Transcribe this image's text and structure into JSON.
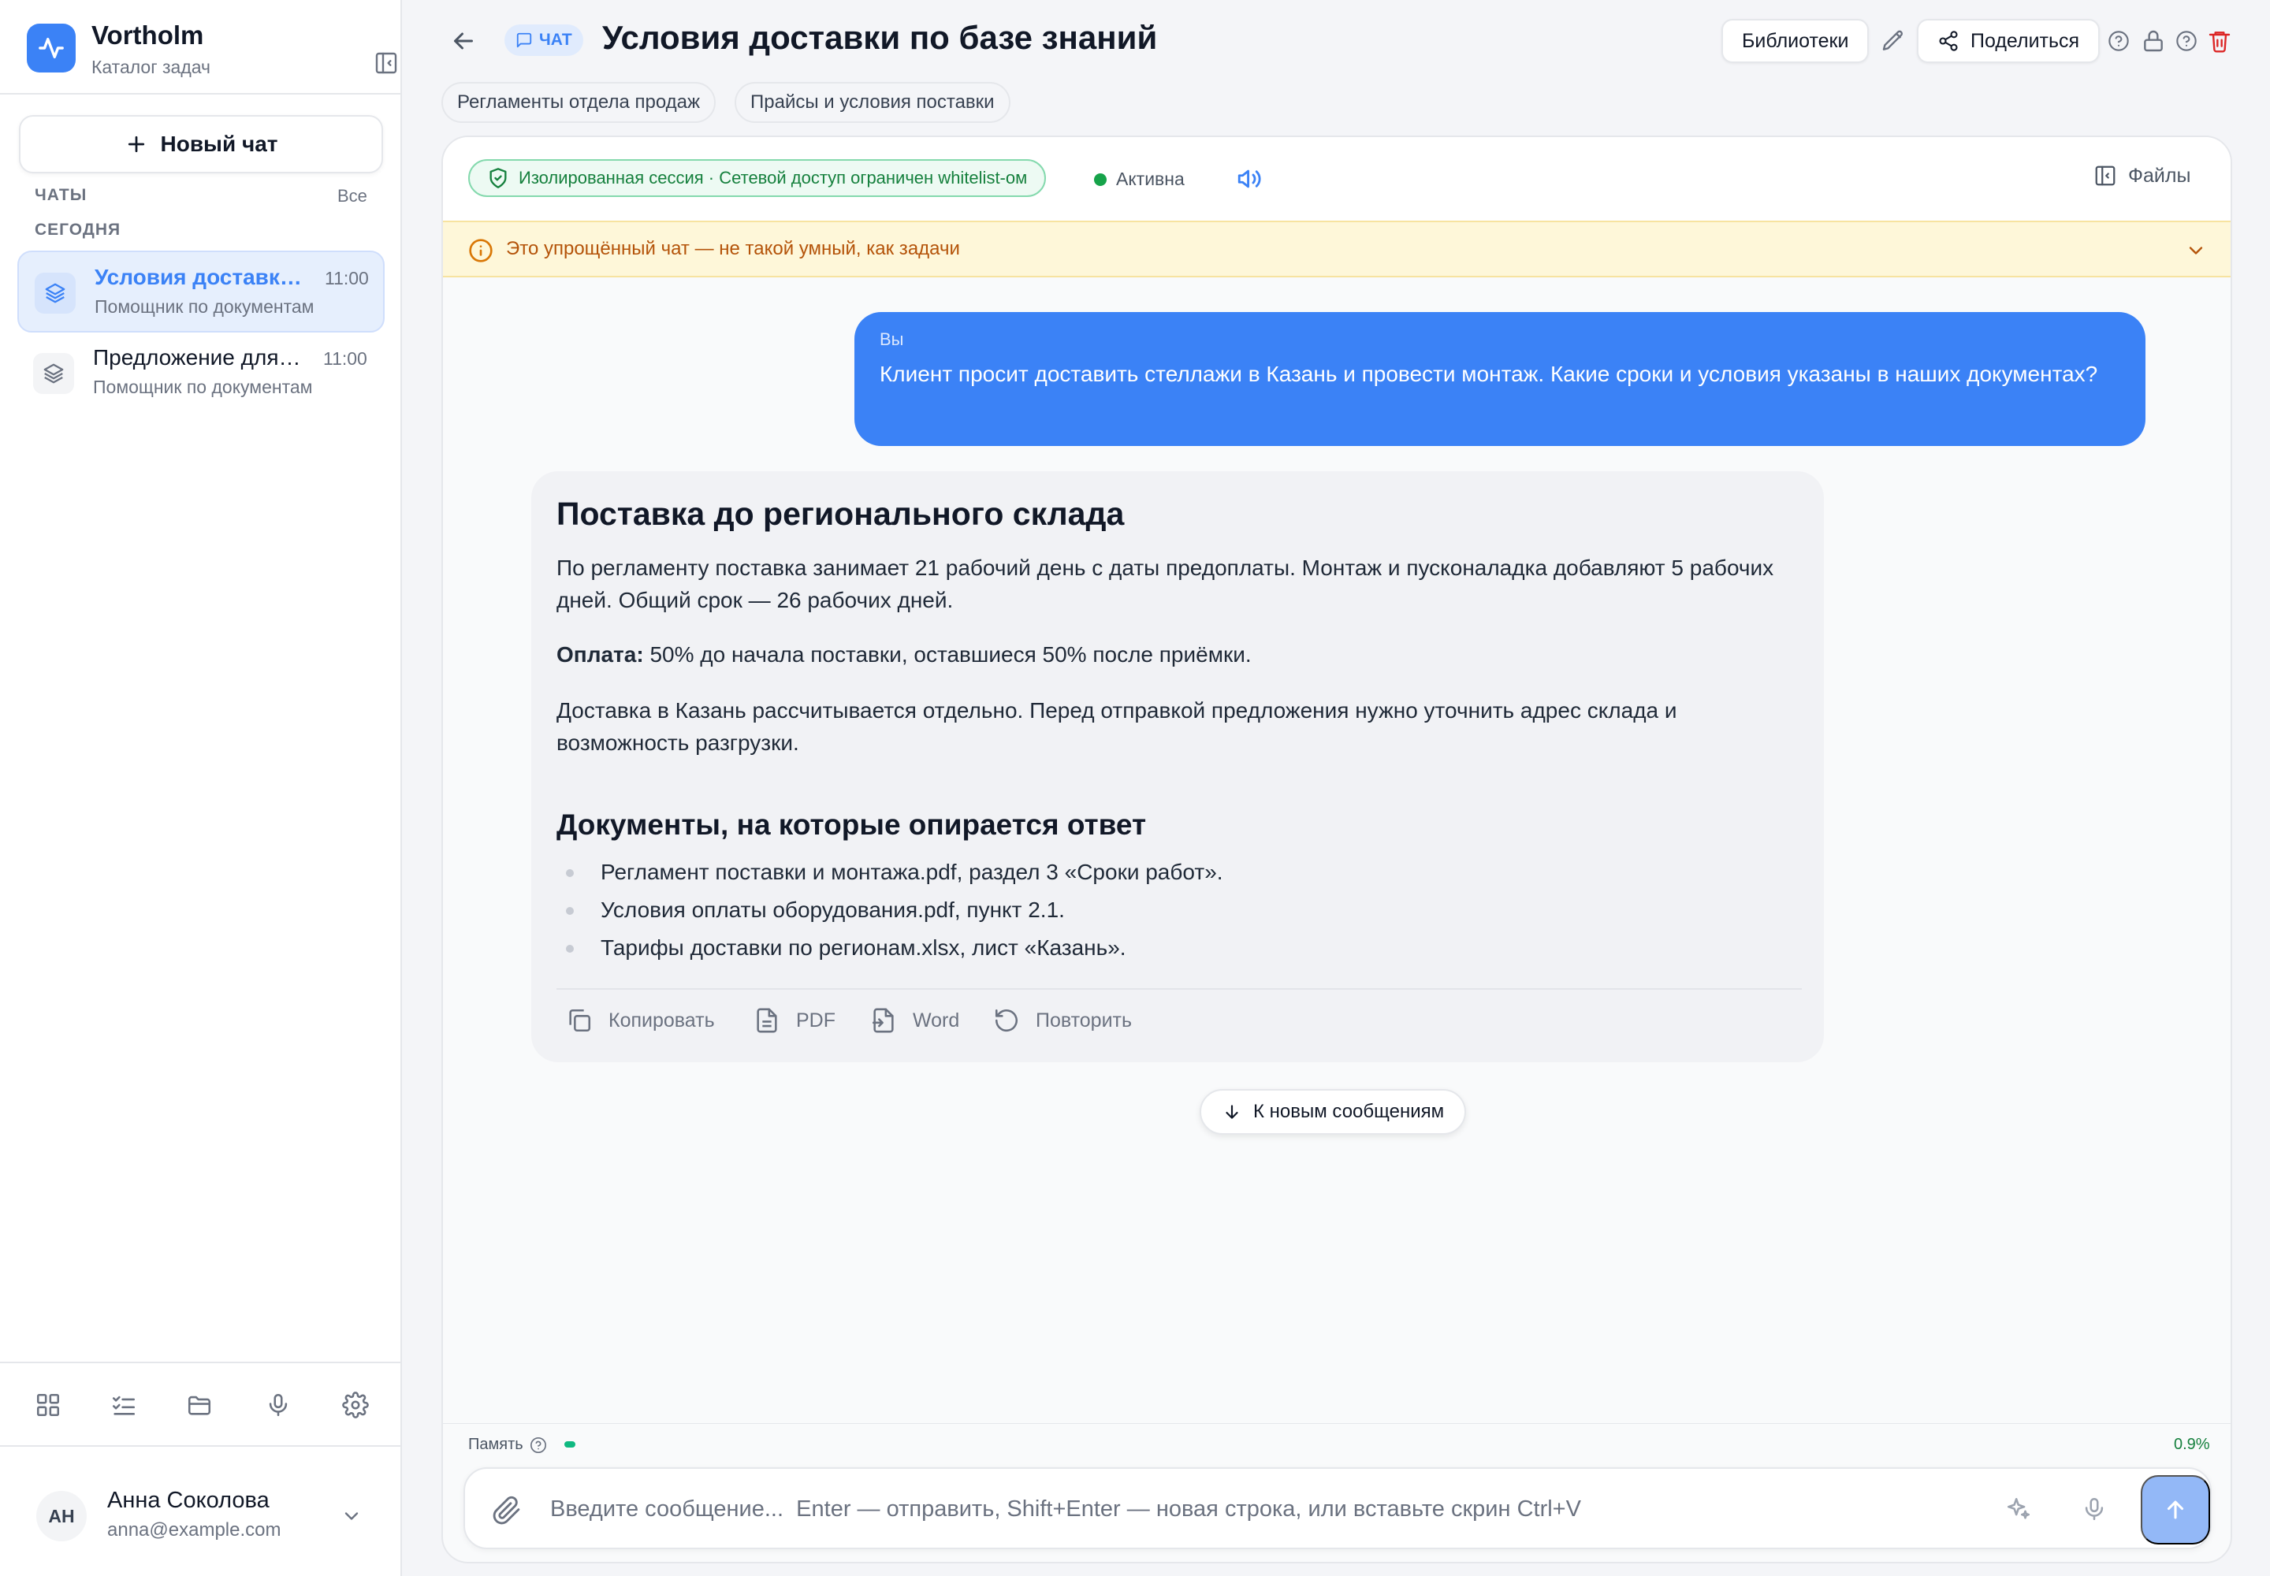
{
  "app": {
    "name": "Vortholm",
    "subtitle": "Каталог задач"
  },
  "sidebar": {
    "new_chat_label": "Новый чат",
    "chats_section": "ЧАТЫ",
    "all_link": "Все",
    "today_section": "СЕГОДНЯ",
    "chats": [
      {
        "title": "Условия доставки по базе знаний",
        "time": "11:00",
        "subtitle": "Помощник по документам",
        "active": true
      },
      {
        "title": "Предложение для нового клиента",
        "time": "11:00",
        "subtitle": "Помощник по документам",
        "active": false
      }
    ],
    "tools": [
      "grid-icon",
      "tasks-icon",
      "folder-icon",
      "microphone-icon",
      "settings-icon"
    ],
    "user": {
      "initials": "АН",
      "name": "Анна Соколова",
      "email": "anna@example.com"
    }
  },
  "header": {
    "badge": "ЧАТ",
    "title": "Условия доставки по базе знаний",
    "libraries_label": "Библиотеки",
    "share_label": "Поделиться",
    "libraries": [
      "Регламенты отдела продаж",
      "Прайсы и условия поставки"
    ]
  },
  "session": {
    "isolation_text": "Изолированная сессия · Сетевой доступ ограничен whitelist-ом",
    "status": "Активна",
    "files_label": "Файлы",
    "warning": "Это упрощённый чат — не такой умный, как задачи"
  },
  "messages": {
    "user": {
      "label": "Вы",
      "text": "Клиент просит доставить стеллажи в Казань и провести монтаж. Какие сроки и условия указаны в наших документах?"
    },
    "assistant": {
      "heading": "Поставка до регионального склада",
      "p1": "По регламенту поставка занимает 21 рабочий день с даты предоплаты. Монтаж и пусконаладка добавляют 5 рабочих дней. Общий срок — 26 рабочих дней.",
      "payment_label": "Оплата:",
      "payment_text": " 50% до начала поставки, оставшиеся 50% после приёмки.",
      "p3": "Доставка в Казань рассчитывается отдельно. Перед отправкой предложения нужно уточнить адрес склада и возможность разгрузки.",
      "docs_heading": "Документы, на которые опирается ответ",
      "docs": [
        "Регламент поставки и монтажа.pdf, раздел 3 «Сроки работ».",
        "Условия оплаты оборудования.pdf, пункт 2.1.",
        "Тарифы доставки по регионам.xlsx, лист «Казань»."
      ],
      "actions": {
        "copy": "Копировать",
        "pdf": "PDF",
        "word": "Word",
        "retry": "Повторить"
      }
    },
    "jump_label": "К новым сообщениям"
  },
  "composer": {
    "memory_label": "Память",
    "memory_percent": "0.9%",
    "memory_fraction": 0.009,
    "placeholder": "Введите сообщение...  Enter — отправить, Shift+Enter — новая строка, или вставьте скрин Ctrl+V"
  },
  "colors": {
    "accent": "#3b82f6",
    "success": "#16a34a",
    "warning_bg": "#fef7d9",
    "danger": "#dc2626"
  }
}
